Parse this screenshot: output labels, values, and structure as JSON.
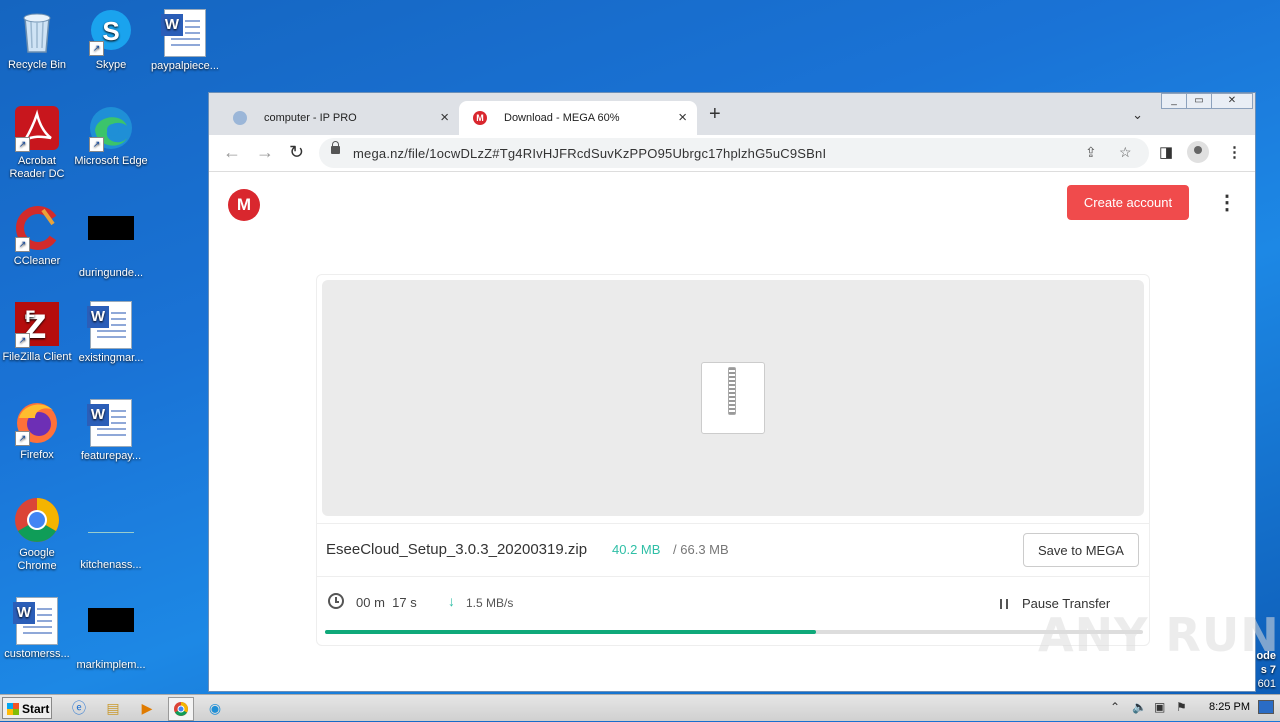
{
  "desktop": {
    "icons": [
      {
        "label": "Recycle Bin"
      },
      {
        "label": "Skype"
      },
      {
        "label": "paypalpiece..."
      },
      {
        "label": "Acrobat Reader DC"
      },
      {
        "label": "Microsoft Edge"
      },
      {
        "label": "CCleaner"
      },
      {
        "label": "duringunde..."
      },
      {
        "label": "FileZilla Client"
      },
      {
        "label": "existingmar..."
      },
      {
        "label": "Firefox"
      },
      {
        "label": "featurepay..."
      },
      {
        "label": "Google Chrome"
      },
      {
        "label": "kitchenass..."
      },
      {
        "label": "customerss..."
      },
      {
        "label": "markimplem..."
      }
    ],
    "side_text": [
      "ode",
      "s 7",
      "601"
    ]
  },
  "browser": {
    "tabs": [
      {
        "title": "computer - IP PRO",
        "active": false
      },
      {
        "title": "Download - MEGA 60%",
        "active": true
      }
    ],
    "new_tab": "+",
    "url": "mega.nz/file/1ocwDLzZ#Tg4RIvHJFRcdSuvKzPPO95Ubrgc17hplzhG5uC9SBnI"
  },
  "mega": {
    "logo": "M",
    "create_account": "Create account",
    "file_name": "EseeCloud_Setup_3.0.3_20200319.zip",
    "downloaded": "40.2 MB",
    "separator": "/",
    "total_size": "66.3 MB",
    "save_button": "Save to MEGA",
    "time_remaining": "00 m  17 s",
    "speed": "1.5 MB/s",
    "pause_label": "Pause Transfer",
    "progress_percent": 60,
    "accent_color": "#f04b4c",
    "progress_color": "#0fa97a"
  },
  "taskbar": {
    "start_label": "Start",
    "time": "8:25 PM"
  },
  "watermark": "ANY RUN"
}
